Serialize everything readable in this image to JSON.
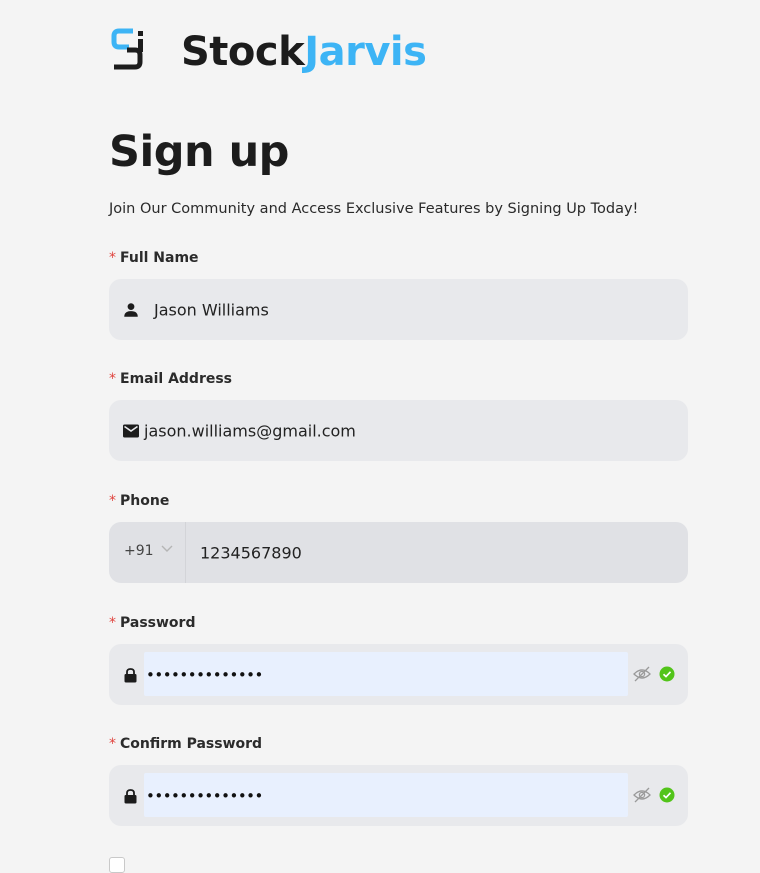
{
  "brand": {
    "part1": "Stock",
    "part2": "Jarvis",
    "accent_color": "#3db4f5",
    "logo_icon": "stockjarvis-logo-icon"
  },
  "page": {
    "title": "Sign up",
    "subtitle": "Join Our Community and Access Exclusive Features by Signing Up Today!"
  },
  "form": {
    "required_mark": "*",
    "full_name": {
      "label": "Full Name",
      "value": "Jason Williams",
      "icon": "user-icon"
    },
    "email": {
      "label": "Email Address",
      "value": "jason.williams@gmail.com",
      "icon": "mail-icon"
    },
    "phone": {
      "label": "Phone",
      "country_code": "+91",
      "value": "1234567890",
      "icon": "chevron-down-icon"
    },
    "password": {
      "label": "Password",
      "value": "••••••••••••••",
      "icon": "lock-icon",
      "toggle_icon": "eye-off-icon",
      "status_icon": "check-circle-icon"
    },
    "confirm_password": {
      "label": "Confirm Password",
      "value": "••••••••••••••",
      "icon": "lock-icon",
      "toggle_icon": "eye-off-icon",
      "status_icon": "check-circle-icon"
    }
  },
  "colors": {
    "required": "#e0443e",
    "valid": "#52c41a",
    "autofill": "#e8f0fe"
  }
}
